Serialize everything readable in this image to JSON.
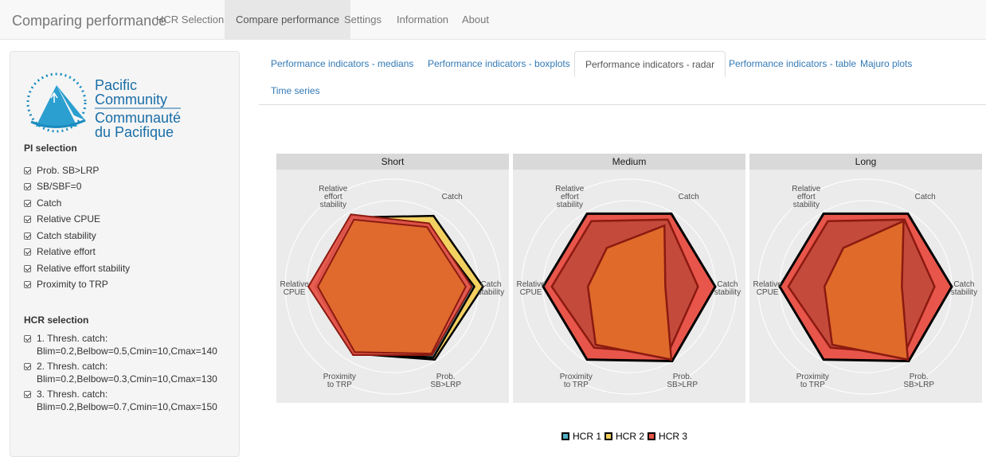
{
  "navbar": {
    "brand": "Comparing performance",
    "items": [
      {
        "label": "HCR Selection",
        "active": false
      },
      {
        "label": "Compare performance",
        "active": true
      },
      {
        "label": "Settings",
        "active": false
      },
      {
        "label": "Information",
        "active": false
      },
      {
        "label": "About",
        "active": false
      }
    ]
  },
  "sidebar": {
    "logo": {
      "line1": "Pacific",
      "line2": "Community",
      "line3": "Communauté",
      "line4": "du Pacifique"
    },
    "pi_title": "PI selection",
    "pi_items": [
      "Prob. SB>LRP",
      "SB/SBF=0",
      "Catch",
      "Relative CPUE",
      "Catch stability",
      "Relative effort",
      "Relative effort stability",
      "Proximity to TRP"
    ],
    "hcr_title": "HCR selection",
    "hcr_items": [
      {
        "line1": "1. Thresh. catch:",
        "line2": "Blim=0.2,Belbow=0.5,Cmin=10,Cmax=140"
      },
      {
        "line1": "2. Thresh. catch:",
        "line2": "Blim=0.2,Belbow=0.3,Cmin=10,Cmax=130"
      },
      {
        "line1": "3. Thresh. catch:",
        "line2": "Blim=0.2,Belbow=0.7,Cmin=10,Cmax=150"
      }
    ]
  },
  "tabs": [
    {
      "label": "Performance indicators - medians",
      "active": false
    },
    {
      "label": "Performance indicators - boxplots",
      "active": false
    },
    {
      "label": "Performance indicators - radar",
      "active": true
    },
    {
      "label": "Performance indicators - table",
      "active": false
    },
    {
      "label": "Majuro plots",
      "active": false
    },
    {
      "label": "Time series",
      "active": false
    }
  ],
  "chart_data": {
    "type": "radar",
    "panels": [
      "Short",
      "Medium",
      "Long"
    ],
    "axes": [
      "Catch",
      "Catch stability",
      "Prob. SB>LRP",
      "Proximity to TRP",
      "Relative CPUE",
      "Relative effort stability"
    ],
    "axis_labels": {
      "catch": [
        "Catch"
      ],
      "catch_stability": [
        "Catch",
        "stability"
      ],
      "prob": [
        "Prob.",
        "SB>LRP"
      ],
      "proximity": [
        "Proximity",
        "to TRP"
      ],
      "cpue": [
        "Relative",
        "CPUE"
      ],
      "effort_stab": [
        "Relative",
        "effort",
        "stability"
      ]
    },
    "series": [
      {
        "name": "HCR 1",
        "color": "#4fb0c6",
        "values": {
          "Short": [
            0.82,
            0.95,
            0.95,
            0.9,
            0.9,
            0.95
          ],
          "Medium": [
            0.98,
            1.0,
            1.0,
            0.98,
            1.0,
            0.98
          ],
          "Long": [
            0.98,
            1.0,
            1.0,
            0.98,
            1.0,
            0.98
          ]
        }
      },
      {
        "name": "HCR 2",
        "color": "#f2d05a",
        "values": {
          "Short": [
            0.95,
            1.05,
            0.98,
            0.9,
            0.9,
            0.93
          ],
          "Medium": [
            0.9,
            0.8,
            0.9,
            0.82,
            0.9,
            0.88
          ],
          "Long": [
            0.9,
            0.8,
            0.9,
            0.82,
            0.9,
            0.88
          ]
        }
      },
      {
        "name": "HCR 3",
        "color": "#e8554a",
        "values": {
          "Short": [
            0.85,
            0.92,
            0.92,
            0.92,
            0.98,
            0.97
          ],
          "Medium": [
            0.98,
            0.72,
            0.98,
            0.78,
            0.72,
            0.62
          ],
          "Long": [
            0.98,
            0.72,
            0.98,
            0.78,
            0.72,
            0.62
          ]
        }
      }
    ],
    "hcr2_inner": {
      "Medium": [
        0.82,
        0.42,
        0.98,
        0.78,
        0.48,
        0.52
      ],
      "Long": [
        0.88,
        0.42,
        0.98,
        0.78,
        0.48,
        0.52
      ]
    },
    "legend": {
      "position": "bottom",
      "items": [
        "HCR 1",
        "HCR 2",
        "HCR 3"
      ]
    }
  }
}
